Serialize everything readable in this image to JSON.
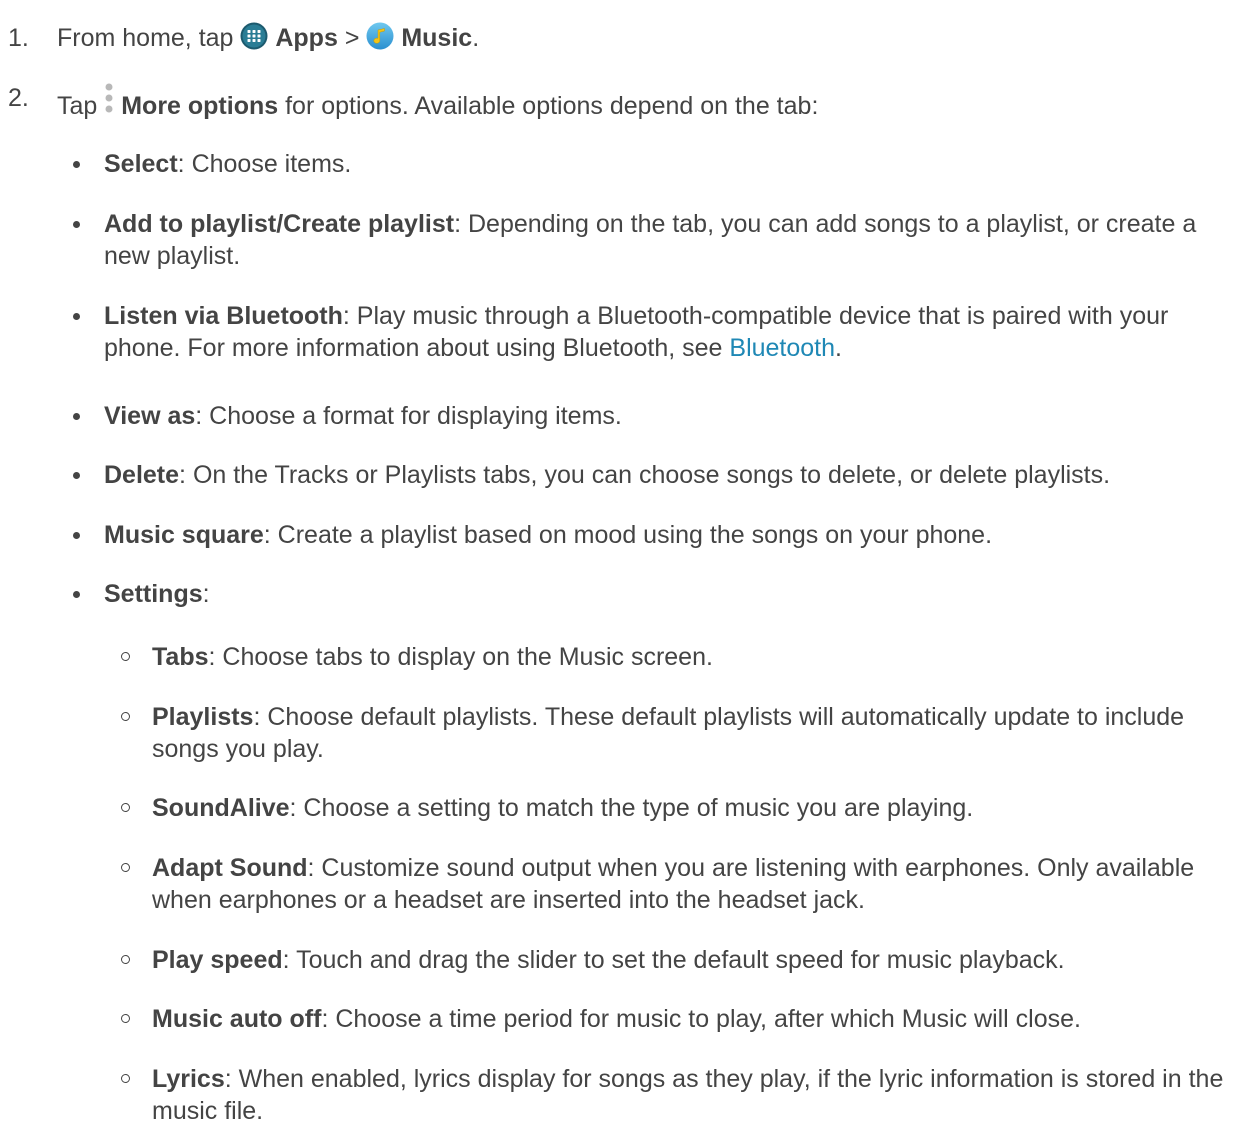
{
  "steps": [
    {
      "number": "1.",
      "prefix": "From home, tap",
      "apps_label": "Apps",
      "separator": ">",
      "music_label": "Music",
      "suffix": "."
    },
    {
      "number": "2.",
      "prefix": "Tap",
      "more_label": "More options",
      "suffix": "for options. Available options depend on the tab:"
    }
  ],
  "options": [
    {
      "term": "Select",
      "desc": ": Choose items."
    },
    {
      "term": "Add to playlist/Create playlist",
      "desc": ": Depending on the tab, you can add songs to a playlist, or create a new playlist."
    },
    {
      "term": "Listen via Bluetooth",
      "desc": ": Play music through a Bluetooth-compatible device that is paired with your phone. For more information about using Bluetooth, see ",
      "link": "Bluetooth",
      "after": "."
    },
    {
      "term": "View as",
      "desc": ": Choose a format for displaying items."
    },
    {
      "term": "Delete",
      "desc": ": On the Tracks or Playlists tabs, you can choose songs to delete, or delete playlists."
    },
    {
      "term": "Music square",
      "desc": ": Create a playlist based on mood using the songs on your phone."
    },
    {
      "term": "Settings",
      "desc": ":"
    }
  ],
  "settings": [
    {
      "term": "Tabs",
      "desc": ": Choose tabs to display on the Music screen."
    },
    {
      "term": "Playlists",
      "desc": ": Choose default playlists. These default playlists will automatically update to include songs you play."
    },
    {
      "term": "SoundAlive",
      "desc": ": Choose a setting to match the type of music you are playing."
    },
    {
      "term": "Adapt Sound",
      "desc": ": Customize sound output when you are listening with earphones. Only available when earphones or a headset are inserted into the headset jack."
    },
    {
      "term": "Play speed",
      "desc": ": Touch and drag the slider to set the default speed for music playback."
    },
    {
      "term": "Music auto off",
      "desc": ": Choose a time period for music to play, after which Music will close."
    },
    {
      "term": "Lyrics",
      "desc": ": When enabled, lyrics display for songs as they play, if the lyric information is stored in the music file."
    }
  ],
  "icons": {
    "apps": "apps-grid-icon",
    "music": "music-note-icon",
    "more": "more-options-icon"
  },
  "colors": {
    "text": "#444444",
    "link": "#1f88b5"
  }
}
